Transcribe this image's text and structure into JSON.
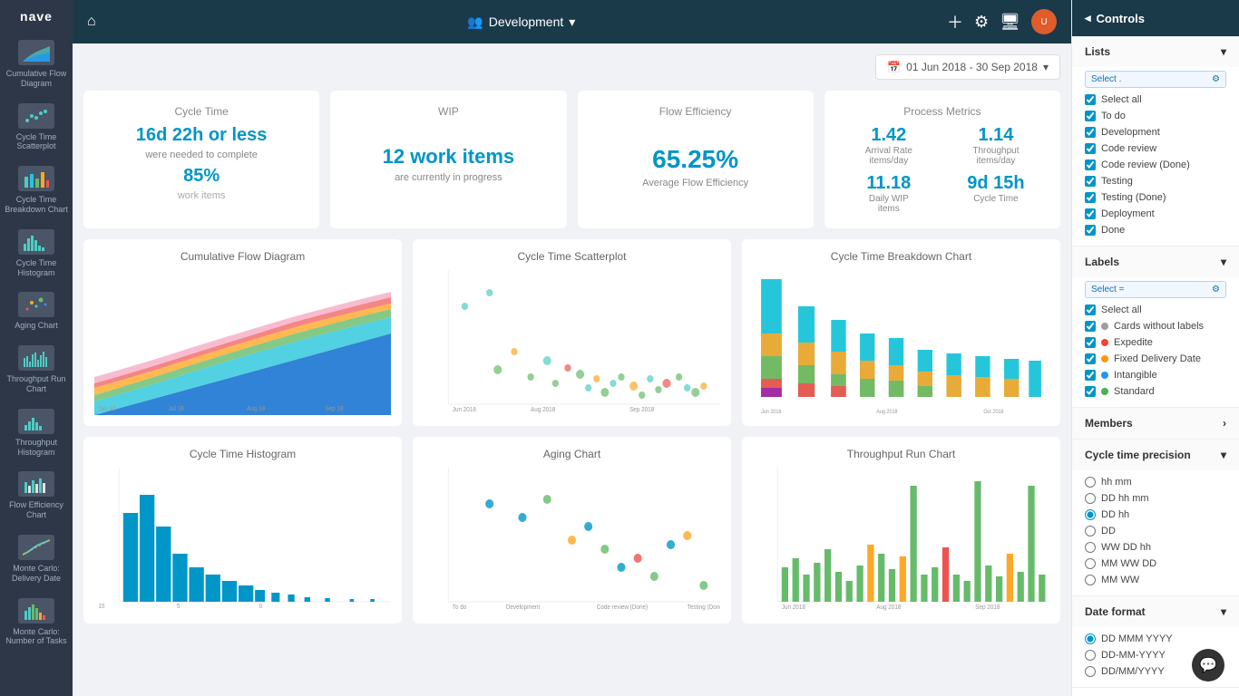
{
  "app": {
    "name": "nave"
  },
  "topbar": {
    "team": "Development",
    "date_range": "01 Jun 2018 - 30 Sep 2018"
  },
  "sidebar": {
    "items": [
      {
        "id": "cumulative-flow",
        "label": "Cumulative Flow Diagram"
      },
      {
        "id": "scatterplot",
        "label": "Cycle Time Scatterplot"
      },
      {
        "id": "breakdown",
        "label": "Cycle Time Breakdown Chart"
      },
      {
        "id": "histogram",
        "label": "Cycle Time Histogram"
      },
      {
        "id": "aging",
        "label": "Aging Chart"
      },
      {
        "id": "throughput-run",
        "label": "Throughput Run Chart"
      },
      {
        "id": "throughput-hist",
        "label": "Throughput Histogram"
      },
      {
        "id": "flow-efficiency",
        "label": "Flow Efficiency Chart"
      },
      {
        "id": "monte-carlo-delivery",
        "label": "Monte Carlo: Delivery Date"
      },
      {
        "id": "monte-carlo-tasks",
        "label": "Monte Carlo: Number of Tasks"
      }
    ]
  },
  "metrics": {
    "cycle_time": {
      "title": "Cycle Time",
      "value": "16d 22h or less",
      "subtitle": "were needed to complete",
      "percent": "85%",
      "unit": "work items"
    },
    "wip": {
      "title": "WIP",
      "value": "12 work items",
      "subtitle": "are currently in progress"
    },
    "flow_efficiency": {
      "title": "Flow Efficiency",
      "value": "65.25%",
      "subtitle": "Average Flow Efficiency"
    },
    "process_metrics": {
      "title": "Process Metrics",
      "arrival_rate_val": "1.42",
      "arrival_rate_lbl": "Arrival Rate",
      "arrival_rate_unit": "items/day",
      "throughput_val": "1.14",
      "throughput_lbl": "Throughput",
      "throughput_unit": "items/day",
      "daily_wip_val": "11.18",
      "daily_wip_lbl": "Daily WIP",
      "daily_wip_unit": "items",
      "cycle_time_val": "9d 15h",
      "cycle_time_lbl": "Cycle Time"
    }
  },
  "charts": {
    "row1": [
      {
        "id": "cfd",
        "title": "Cumulative Flow Diagram"
      },
      {
        "id": "scatter",
        "title": "Cycle Time Scatterplot"
      },
      {
        "id": "breakdown",
        "title": "Cycle Time Breakdown Chart"
      }
    ],
    "row2": [
      {
        "id": "histogram",
        "title": "Cycle Time Histogram"
      },
      {
        "id": "aging",
        "title": "Aging Chart"
      },
      {
        "id": "throughput-run",
        "title": "Throughput Run Chart"
      }
    ]
  },
  "controls": {
    "header": "Controls",
    "lists": {
      "label": "Lists",
      "select_filter": "Select .",
      "items": [
        {
          "id": "select-all",
          "label": "Select all",
          "checked": true
        },
        {
          "id": "to-do",
          "label": "To do",
          "checked": true
        },
        {
          "id": "development",
          "label": "Development",
          "checked": true
        },
        {
          "id": "code-review",
          "label": "Code review",
          "checked": true
        },
        {
          "id": "code-review-done",
          "label": "Code review (Done)",
          "checked": true
        },
        {
          "id": "testing",
          "label": "Testing",
          "checked": true
        },
        {
          "id": "testing-done",
          "label": "Testing (Done)",
          "checked": true
        },
        {
          "id": "deployment",
          "label": "Deployment",
          "checked": true
        },
        {
          "id": "done",
          "label": "Done",
          "checked": true
        }
      ]
    },
    "labels": {
      "label": "Labels",
      "select_filter": "Select =",
      "cards_without_label": "Cards without labels",
      "items": [
        {
          "id": "select-all",
          "label": "Select all",
          "checked": true,
          "color": null
        },
        {
          "id": "cards-no-label",
          "label": "Cards without labels",
          "checked": true,
          "color": "#9e9e9e"
        },
        {
          "id": "expedite",
          "label": "Expedite",
          "checked": true,
          "color": "#f44336"
        },
        {
          "id": "fixed-delivery",
          "label": "Fixed Delivery Date",
          "checked": true,
          "color": "#ff9800"
        },
        {
          "id": "intangible",
          "label": "Intangible",
          "checked": true,
          "color": "#2196f3"
        },
        {
          "id": "standard",
          "label": "Standard",
          "checked": true,
          "color": "#4caf50"
        }
      ]
    },
    "members": {
      "label": "Members"
    },
    "cycle_time_precision": {
      "label": "Cycle time precision",
      "options": [
        {
          "id": "hh-mm",
          "label": "hh mm",
          "selected": false
        },
        {
          "id": "dd-hh-mm",
          "label": "DD hh mm",
          "selected": false
        },
        {
          "id": "dd-hh",
          "label": "DD hh",
          "selected": true
        },
        {
          "id": "dd",
          "label": "DD",
          "selected": false
        },
        {
          "id": "ww-dd-hh",
          "label": "WW DD hh",
          "selected": false
        },
        {
          "id": "mm-ww-dd",
          "label": "MM WW DD",
          "selected": false
        },
        {
          "id": "mm-ww",
          "label": "MM WW",
          "selected": false
        }
      ]
    },
    "date_format": {
      "label": "Date format",
      "options": [
        {
          "id": "dd-mmm-yyyy",
          "label": "DD MMM YYYY",
          "selected": true
        },
        {
          "id": "dd-mm-yyyy",
          "label": "DD-MM-YYYY",
          "selected": false
        },
        {
          "id": "dd-mm-yyyy2",
          "label": "DD/MM/YYYY",
          "selected": false
        }
      ]
    }
  }
}
